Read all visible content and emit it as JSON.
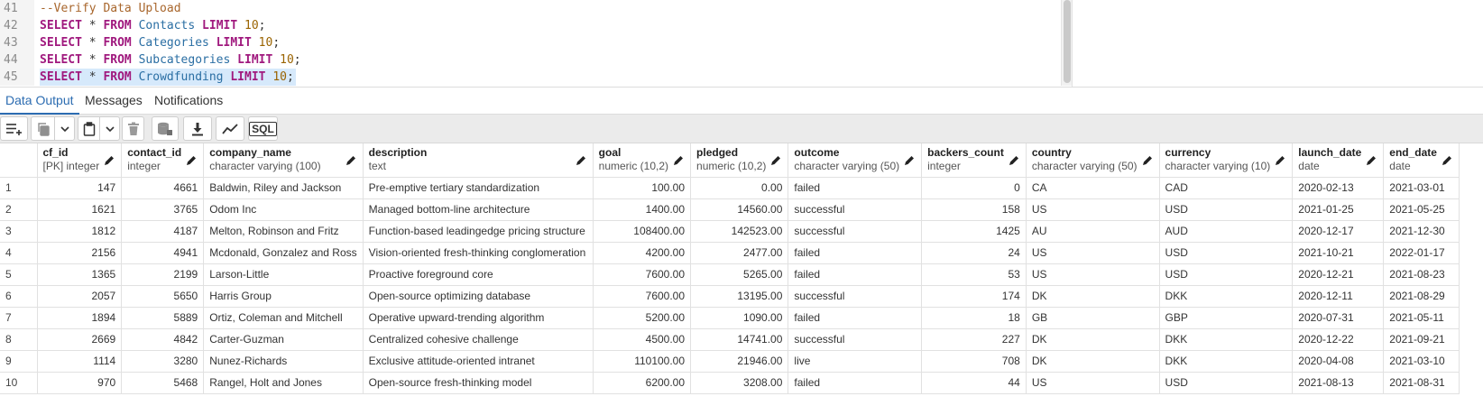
{
  "editor": {
    "lines": [
      {
        "num": "41",
        "tokens": [
          {
            "t": "--Verify Data Upload",
            "c": "comment"
          }
        ]
      },
      {
        "num": "42",
        "tokens": [
          {
            "t": "SELECT",
            "c": "kw"
          },
          {
            "t": " * ",
            "c": "op"
          },
          {
            "t": "FROM",
            "c": "kw"
          },
          {
            "t": " Contacts ",
            "c": "id"
          },
          {
            "t": "LIMIT",
            "c": "kw"
          },
          {
            "t": " ",
            "c": "op"
          },
          {
            "t": "10",
            "c": "num"
          },
          {
            "t": ";",
            "c": "op"
          }
        ]
      },
      {
        "num": "43",
        "tokens": [
          {
            "t": "SELECT",
            "c": "kw"
          },
          {
            "t": " * ",
            "c": "op"
          },
          {
            "t": "FROM",
            "c": "kw"
          },
          {
            "t": " Categories ",
            "c": "id"
          },
          {
            "t": "LIMIT",
            "c": "kw"
          },
          {
            "t": " ",
            "c": "op"
          },
          {
            "t": "10",
            "c": "num"
          },
          {
            "t": ";",
            "c": "op"
          }
        ]
      },
      {
        "num": "44",
        "tokens": [
          {
            "t": "SELECT",
            "c": "kw"
          },
          {
            "t": " * ",
            "c": "op"
          },
          {
            "t": "FROM",
            "c": "kw"
          },
          {
            "t": " Subcategories ",
            "c": "id"
          },
          {
            "t": "LIMIT",
            "c": "kw"
          },
          {
            "t": " ",
            "c": "op"
          },
          {
            "t": "10",
            "c": "num"
          },
          {
            "t": ";",
            "c": "op"
          }
        ]
      },
      {
        "num": "45",
        "selected": true,
        "tokens": [
          {
            "t": "SELECT",
            "c": "kw"
          },
          {
            "t": " * ",
            "c": "op"
          },
          {
            "t": "FROM",
            "c": "kw"
          },
          {
            "t": " Crowdfunding ",
            "c": "id"
          },
          {
            "t": "LIMIT",
            "c": "kw"
          },
          {
            "t": " ",
            "c": "op"
          },
          {
            "t": "10",
            "c": "num"
          },
          {
            "t": ";",
            "c": "op"
          }
        ]
      }
    ]
  },
  "tabs": {
    "data_output": "Data Output",
    "messages": "Messages",
    "notifications": "Notifications"
  },
  "toolbar": {
    "icons": [
      "add-row-icon",
      "copy-icon",
      "chevron-down-icon",
      "paste-icon",
      "chevron-down-icon",
      "delete-icon",
      "save-data-icon",
      "download-icon",
      "graph-icon",
      "sql-icon"
    ],
    "sql_label": "SQL"
  },
  "grid": {
    "columns": [
      {
        "name": "cf_id",
        "type": "[PK] integer",
        "align": "num"
      },
      {
        "name": "contact_id",
        "type": "integer",
        "align": "num"
      },
      {
        "name": "company_name",
        "type": "character varying (100)",
        "align": "text"
      },
      {
        "name": "description",
        "type": "text",
        "align": "text"
      },
      {
        "name": "goal",
        "type": "numeric (10,2)",
        "align": "num"
      },
      {
        "name": "pledged",
        "type": "numeric (10,2)",
        "align": "num"
      },
      {
        "name": "outcome",
        "type": "character varying (50)",
        "align": "text"
      },
      {
        "name": "backers_count",
        "type": "integer",
        "align": "num"
      },
      {
        "name": "country",
        "type": "character varying (50)",
        "align": "text"
      },
      {
        "name": "currency",
        "type": "character varying (10)",
        "align": "text"
      },
      {
        "name": "launch_date",
        "type": "date",
        "align": "text"
      },
      {
        "name": "end_date",
        "type": "date",
        "align": "text"
      }
    ],
    "rows": [
      [
        "1",
        "147",
        "4661",
        "Baldwin, Riley and Jackson",
        "Pre-emptive tertiary standardization",
        "100.00",
        "0.00",
        "failed",
        "0",
        "CA",
        "CAD",
        "2020-02-13",
        "2021-03-01"
      ],
      [
        "2",
        "1621",
        "3765",
        "Odom Inc",
        "Managed bottom-line architecture",
        "1400.00",
        "14560.00",
        "successful",
        "158",
        "US",
        "USD",
        "2021-01-25",
        "2021-05-25"
      ],
      [
        "3",
        "1812",
        "4187",
        "Melton, Robinson and Fritz",
        "Function-based leadingedge pricing structure",
        "108400.00",
        "142523.00",
        "successful",
        "1425",
        "AU",
        "AUD",
        "2020-12-17",
        "2021-12-30"
      ],
      [
        "4",
        "2156",
        "4941",
        "Mcdonald, Gonzalez and Ross",
        "Vision-oriented fresh-thinking conglomeration",
        "4200.00",
        "2477.00",
        "failed",
        "24",
        "US",
        "USD",
        "2021-10-21",
        "2022-01-17"
      ],
      [
        "5",
        "1365",
        "2199",
        "Larson-Little",
        "Proactive foreground core",
        "7600.00",
        "5265.00",
        "failed",
        "53",
        "US",
        "USD",
        "2020-12-21",
        "2021-08-23"
      ],
      [
        "6",
        "2057",
        "5650",
        "Harris Group",
        "Open-source optimizing database",
        "7600.00",
        "13195.00",
        "successful",
        "174",
        "DK",
        "DKK",
        "2020-12-11",
        "2021-08-29"
      ],
      [
        "7",
        "1894",
        "5889",
        "Ortiz, Coleman and Mitchell",
        "Operative upward-trending algorithm",
        "5200.00",
        "1090.00",
        "failed",
        "18",
        "GB",
        "GBP",
        "2020-07-31",
        "2021-05-11"
      ],
      [
        "8",
        "2669",
        "4842",
        "Carter-Guzman",
        "Centralized cohesive challenge",
        "4500.00",
        "14741.00",
        "successful",
        "227",
        "DK",
        "DKK",
        "2020-12-22",
        "2021-09-21"
      ],
      [
        "9",
        "1114",
        "3280",
        "Nunez-Richards",
        "Exclusive attitude-oriented intranet",
        "110100.00",
        "21946.00",
        "live",
        "708",
        "DK",
        "DKK",
        "2020-04-08",
        "2021-03-10"
      ],
      [
        "10",
        "970",
        "5468",
        "Rangel, Holt and Jones",
        "Open-source fresh-thinking model",
        "6200.00",
        "3208.00",
        "failed",
        "44",
        "US",
        "USD",
        "2021-08-13",
        "2021-08-31"
      ]
    ]
  }
}
